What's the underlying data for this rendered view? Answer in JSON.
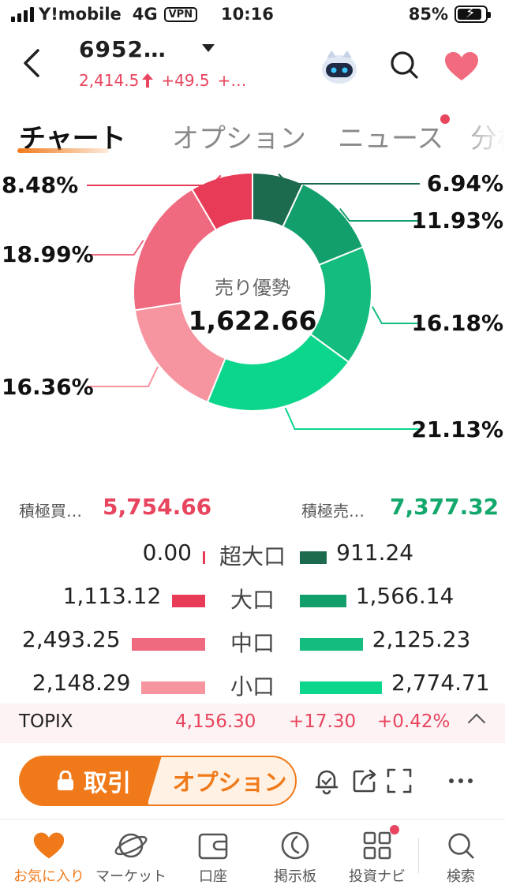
{
  "status_bar": {
    "carrier": "Y!mobile",
    "network": "4G",
    "vpn": "VPN",
    "time": "10:16",
    "battery": "85%"
  },
  "header": {
    "title": "6952…",
    "price": "2,414.5",
    "change": "+49.5",
    "change_pct": "+…"
  },
  "tabs": [
    "チャート",
    "オプション",
    "ニュース",
    "分析"
  ],
  "donut": {
    "center_label": "売り優勢",
    "center_value": "1,622.66",
    "slices": [
      {
        "label": "6.94%",
        "value": 6.94,
        "color": "#1d6b4f"
      },
      {
        "label": "11.93%",
        "value": 11.93,
        "color": "#139f6c"
      },
      {
        "label": "16.18%",
        "value": 16.18,
        "color": "#14bd7d"
      },
      {
        "label": "21.13%",
        "value": 21.13,
        "color": "#0cd68c"
      },
      {
        "label": "16.36%",
        "value": 16.36,
        "color": "#f6949f"
      },
      {
        "label": "18.99%",
        "value": 18.99,
        "color": "#f06a7f"
      },
      {
        "label": "8.48%",
        "value": 8.48,
        "color": "#e83b58"
      }
    ]
  },
  "totals": {
    "buy_label": "積極買…",
    "buy_value": "5,754.66",
    "sell_label": "積極売…",
    "sell_value": "7,377.32"
  },
  "orders": [
    {
      "name": "超大口",
      "buy": "0.00",
      "sell": "911.24",
      "buy_n": 0.0,
      "sell_n": 911.24,
      "buy_color": "#e83b58",
      "sell_color": "#1d6b4f"
    },
    {
      "name": "大口",
      "buy": "1,113.12",
      "sell": "1,566.14",
      "buy_n": 1113.12,
      "sell_n": 1566.14,
      "buy_color": "#e83b58",
      "sell_color": "#139f6c"
    },
    {
      "name": "中口",
      "buy": "2,493.25",
      "sell": "2,125.23",
      "buy_n": 2493.25,
      "sell_n": 2125.23,
      "buy_color": "#f06a7f",
      "sell_color": "#14bd7d"
    },
    {
      "name": "小口",
      "buy": "2,148.29",
      "sell": "2,774.71",
      "buy_n": 2148.29,
      "sell_n": 2774.71,
      "buy_color": "#f6949f",
      "sell_color": "#0cd68c"
    }
  ],
  "topix": {
    "name": "TOPIX",
    "value": "4,156.30",
    "change": "+17.30",
    "change_pct": "+0.42%"
  },
  "actions": {
    "trade": "取引",
    "option": "オプション"
  },
  "bottom_nav": [
    {
      "label": "お気に入り",
      "icon": "heart-icon"
    },
    {
      "label": "マーケット",
      "icon": "planet-icon"
    },
    {
      "label": "口座",
      "icon": "wallet-icon"
    },
    {
      "label": "掲示板",
      "icon": "board-icon"
    },
    {
      "label": "投資ナビ",
      "icon": "grid-icon"
    },
    {
      "label": "検索",
      "icon": "search-icon"
    }
  ],
  "colors": {
    "accent": "#f07a1a",
    "up": "#e8455e",
    "down": "#14a86c"
  }
}
